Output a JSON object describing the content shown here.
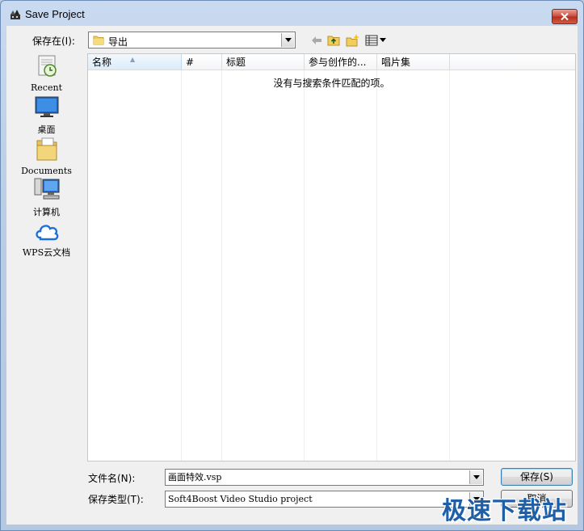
{
  "window": {
    "title": "Save Project"
  },
  "save_in": {
    "label": "保存在(I):",
    "value": "导出"
  },
  "toolbar": {
    "icons": [
      "back-arrow-icon",
      "up-folder-icon",
      "new-folder-icon",
      "view-menu-icon"
    ]
  },
  "places": [
    {
      "label": "Recent",
      "icon": "recent-icon"
    },
    {
      "label": "桌面",
      "icon": "desktop-icon"
    },
    {
      "label": "Documents",
      "icon": "documents-icon"
    },
    {
      "label": "计算机",
      "icon": "computer-icon"
    },
    {
      "label": "WPS云文档",
      "icon": "wps-cloud-icon"
    }
  ],
  "columns": [
    "名称",
    "#",
    "标题",
    "参与创作的...",
    "唱片集"
  ],
  "empty_message": "没有与搜索条件匹配的项。",
  "file_name": {
    "label": "文件名(N):",
    "value": "画面特效.vsp"
  },
  "file_type": {
    "label": "保存类型(T):",
    "value": "Soft4Boost Video Studio project"
  },
  "buttons": {
    "save": "保存(S)",
    "cancel": "取消"
  },
  "watermark": "极速下载站",
  "colors": {
    "accent": "#3c7fb1",
    "title_gradient": "#c9daf0",
    "close": "#c9493a"
  }
}
